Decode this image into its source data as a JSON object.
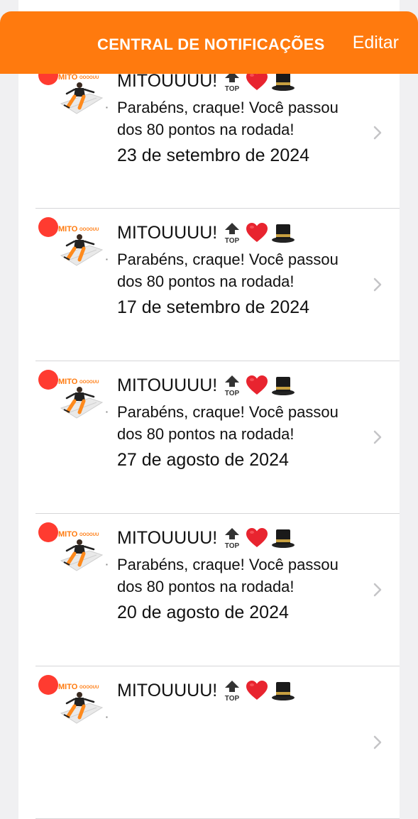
{
  "header": {
    "title": "CENTRAL DE NOTIFICAÇÕES",
    "edit_label": "Editar"
  },
  "colors": {
    "brand_orange": "#ff7a0e",
    "unread_dot": "#ff3b30",
    "divider": "#d6d6d8"
  },
  "notifications": [
    {
      "title": "MITOUUUU!",
      "body": "Parabéns, craque! Você passou dos 80 pontos na rodada!",
      "date": "23 de setembro de 2024",
      "unread": true
    },
    {
      "title": "MITOUUUU!",
      "body": "Parabéns, craque! Você passou dos 80 pontos na rodada!",
      "date": "17 de setembro de 2024",
      "unread": true
    },
    {
      "title": "MITOUUUU!",
      "body": "Parabéns, craque! Você passou dos 80 pontos na rodada!",
      "date": "27 de agosto de 2024",
      "unread": true
    },
    {
      "title": "MITOUUUU!",
      "body": "Parabéns, craque! Você passou dos 80 pontos na rodada!",
      "date": "20 de agosto de 2024",
      "unread": true
    },
    {
      "title": "MITOUUUU!",
      "body": "",
      "date": "",
      "unread": true
    }
  ],
  "icons": {
    "thumbnail": "mito-logo-player-icon",
    "emoji_1": "top-arrow-icon",
    "emoji_2": "red-heart-icon",
    "emoji_3": "top-hat-icon",
    "chevron": "chevron-right-icon"
  }
}
